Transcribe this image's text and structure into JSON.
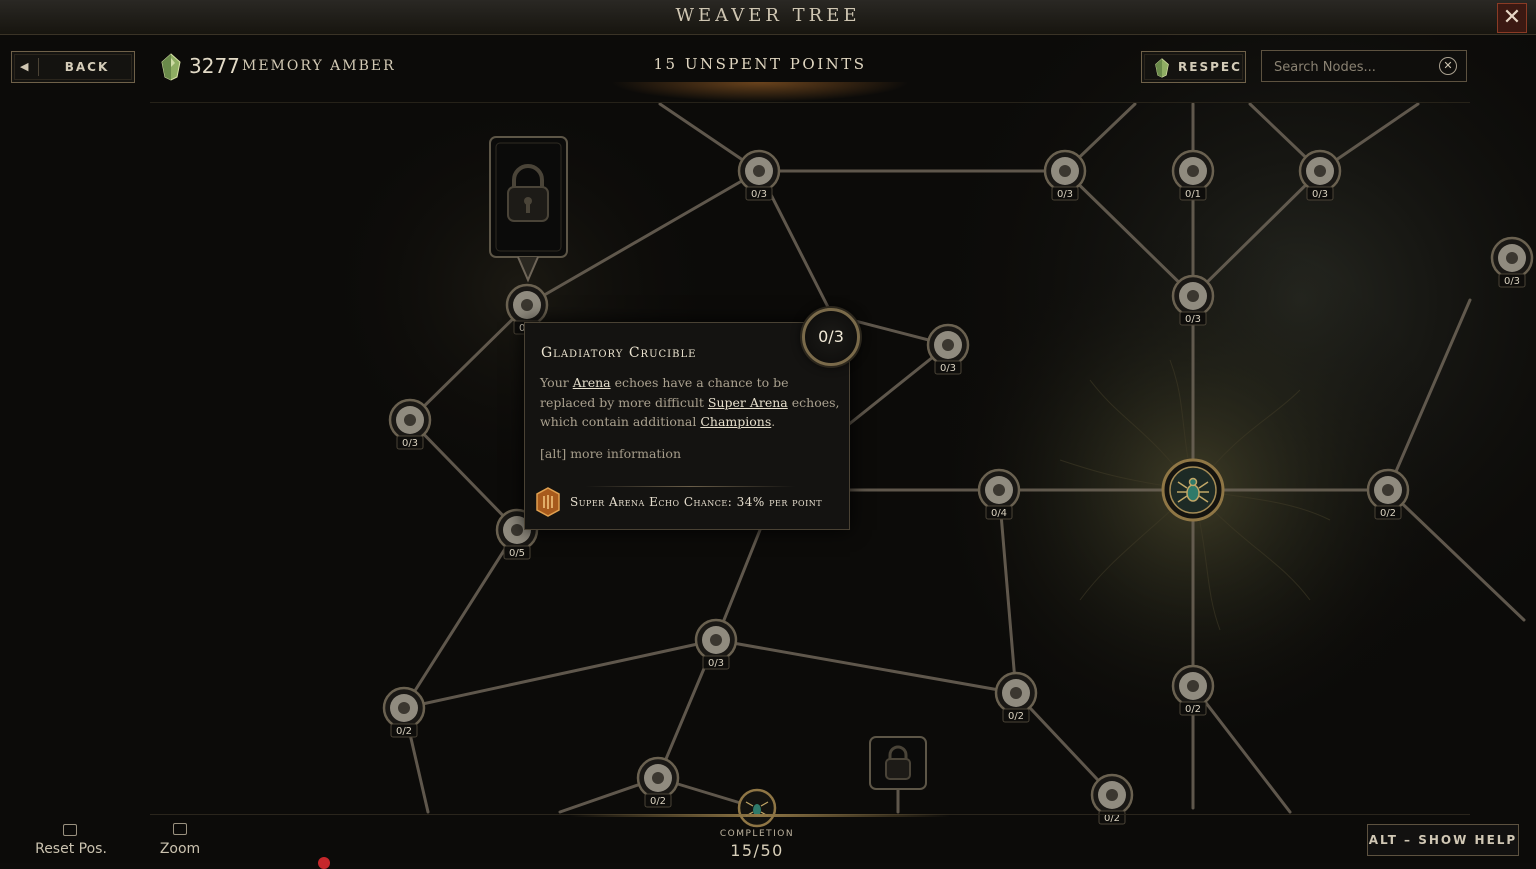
{
  "window": {
    "title": "WEAVER TREE",
    "close_icon": "close-x-icon"
  },
  "header": {
    "back_label": "BACK",
    "currency_value": "3277",
    "currency_label": "MEMORY AMBER",
    "currency_icon": "amber-crystal-icon",
    "unspent_points": "15 UNSPENT POINTS",
    "respec_label": "RESPEC",
    "search_placeholder": "Search Nodes..."
  },
  "nodes": [
    {
      "id": "n1",
      "rank": "0/3",
      "icon": "crystal-cluster-icon"
    },
    {
      "id": "n2",
      "rank": "0/3",
      "icon": "ghost-pair-icon"
    },
    {
      "id": "n3",
      "rank": "0/1",
      "icon": "hooded-figure-icon"
    },
    {
      "id": "n4",
      "rank": "0/3",
      "icon": "spectre-icon"
    },
    {
      "id": "n5",
      "rank": "0/3",
      "icon": "fist-icon"
    },
    {
      "id": "n6",
      "rank": "0/3",
      "icon": "skull-helm-icon"
    },
    {
      "id": "n7",
      "rank": "0/3",
      "icon": "parchment-icon"
    },
    {
      "id": "n8",
      "rank": "0/3",
      "icon": "rune-grid-icon"
    },
    {
      "id": "n9",
      "rank": "0/5",
      "icon": "sword-icon"
    },
    {
      "id": "n10",
      "rank": "0/4",
      "icon": "star-burst-icon"
    },
    {
      "id": "n11",
      "rank": "0/2",
      "icon": "eye-orb-icon"
    },
    {
      "id": "n12",
      "rank": "0/3",
      "icon": "vortex-icon"
    },
    {
      "id": "n13",
      "rank": "0/2",
      "icon": "trident-icon"
    },
    {
      "id": "n14",
      "rank": "0/2",
      "icon": "snowflake-icon"
    },
    {
      "id": "n15",
      "rank": "0/2",
      "icon": "beast-icon"
    },
    {
      "id": "n16",
      "rank": "0/2",
      "icon": "hand-flame-icon"
    },
    {
      "id": "n17",
      "rank": "0/2",
      "icon": "crown-icon"
    },
    {
      "id": "n18",
      "rank": "0/3",
      "icon": "gladiator-arena-icon"
    }
  ],
  "tooltip": {
    "title": "Gladiatory Crucible",
    "desc_1": "Your ",
    "link_1": "Arena",
    "desc_2": " echoes have a chance to be replaced by more difficult ",
    "link_2": "Super Arena",
    "desc_3": " echoes, which contain additional ",
    "link_3": "Champions",
    "desc_4": ".",
    "more_info": "[alt] more information",
    "stat": "Super Arena Echo Chance: 34% per point",
    "rank": "0/3"
  },
  "footer": {
    "reset_label": "Reset Pos.",
    "zoom_label": "Zoom",
    "completion_label": "COMPLETION",
    "completion_value": "15/50",
    "help_label": "ALT – SHOW HELP"
  },
  "colors": {
    "background": "#0d0c0a",
    "line": "#6e6558",
    "gold_accent": "#8f7645",
    "close_red": "#3b1912",
    "amber": "#a6c27a"
  }
}
